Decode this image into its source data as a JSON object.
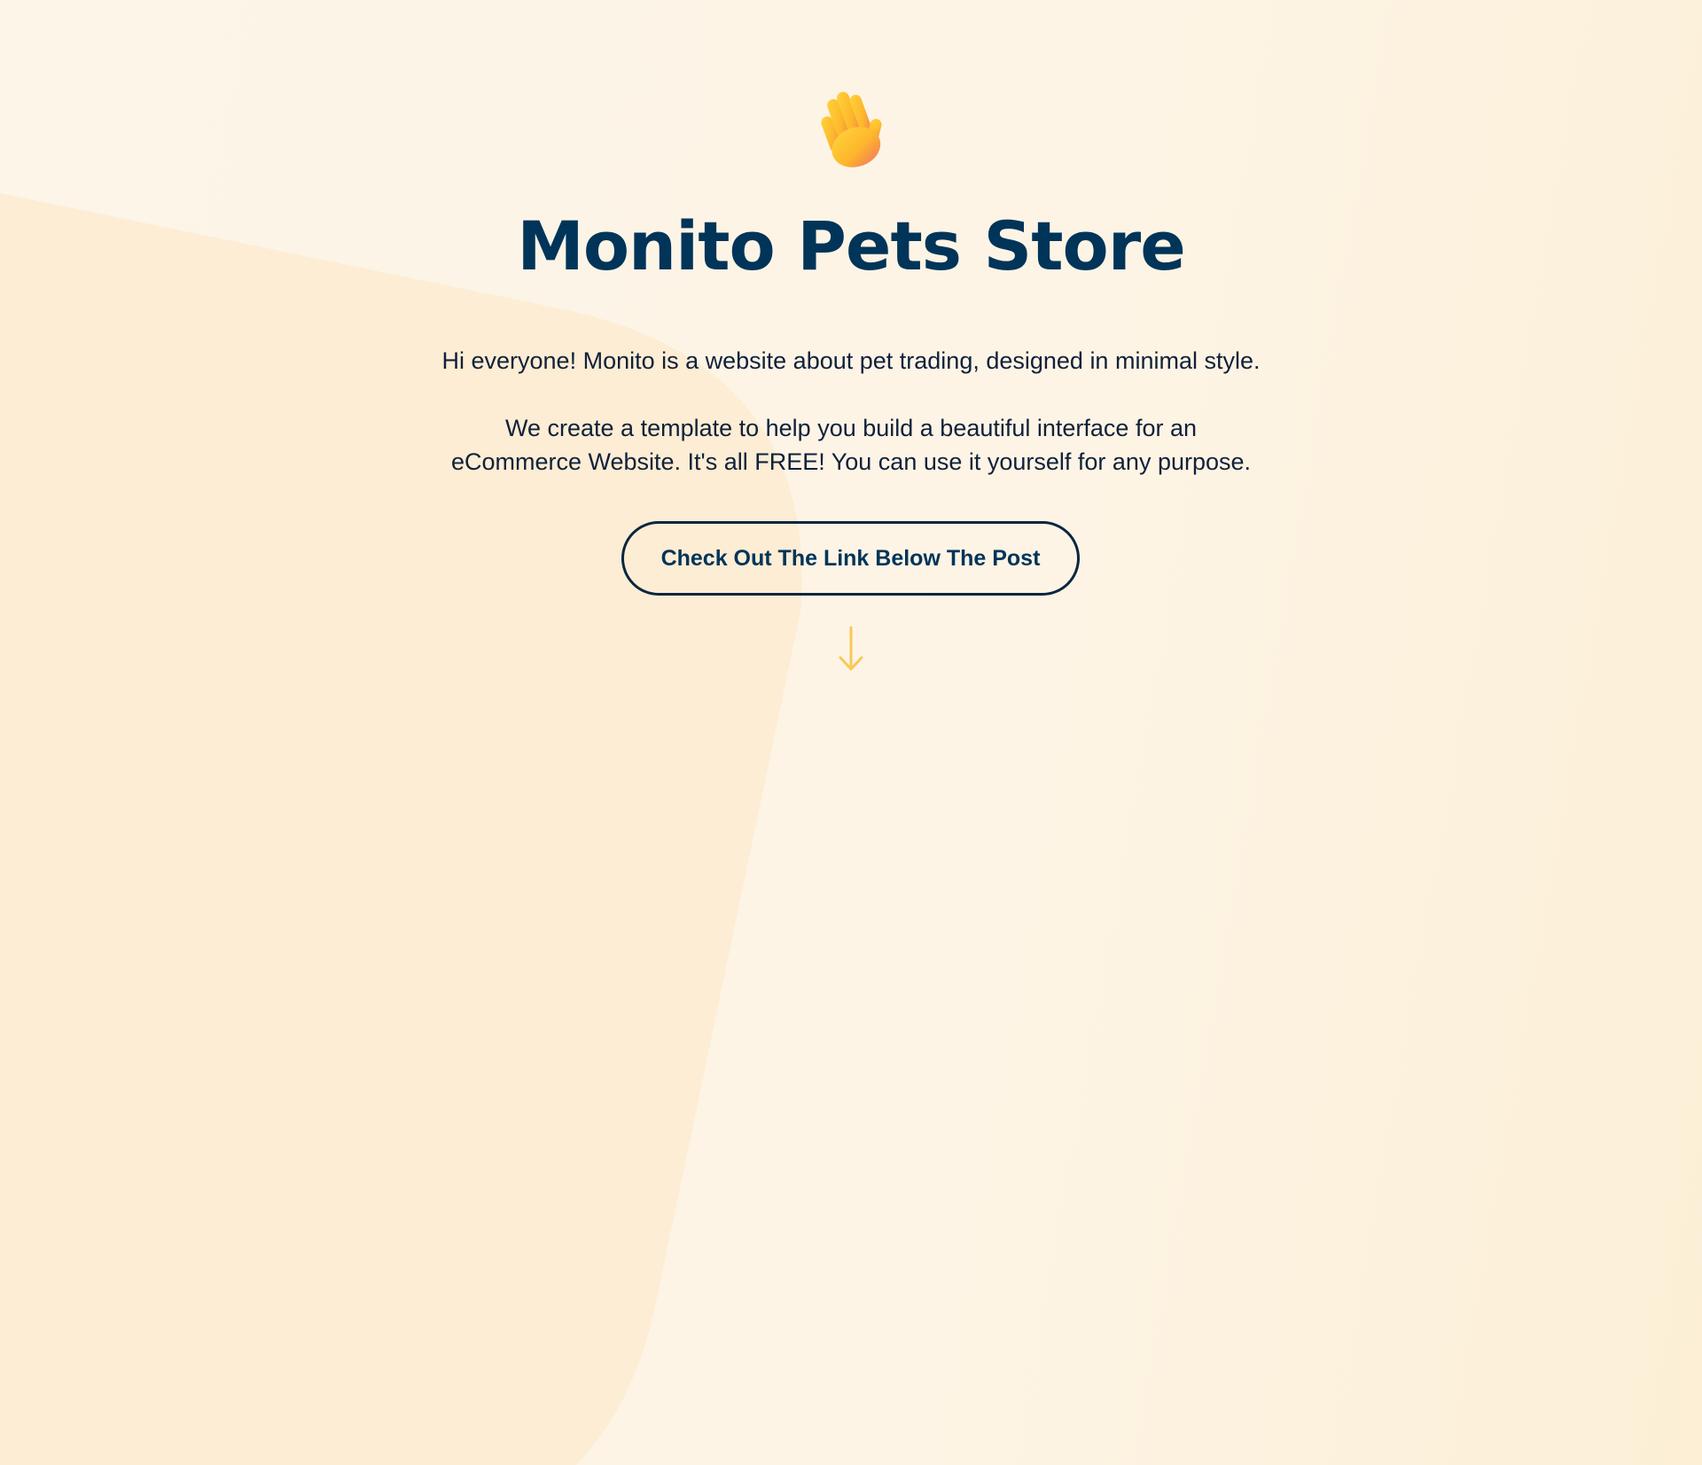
{
  "hero": {
    "wave_icon": "waving-hand-icon",
    "title": "Monito Pets Store",
    "intro": "Hi everyone! Monito is a website about pet trading, designed in minimal style.",
    "description_line1": "We create a template to help you build a beautiful interface for an",
    "description_line2": "eCommerce Website. It's all FREE! You can use it yourself for any purpose.",
    "cta_label": "Check Out The Link Below The Post",
    "arrow_icon": "arrow-down-icon"
  },
  "colors": {
    "background": "#fdf4e5",
    "shape": "#fcedd4",
    "title": "#003459",
    "text": "#10213a",
    "accent": "#f7c95a"
  }
}
